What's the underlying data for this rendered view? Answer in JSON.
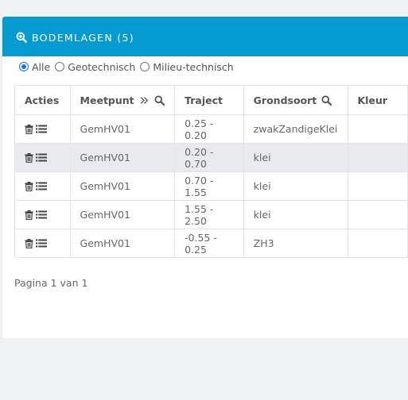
{
  "panel": {
    "title": "BODEMLAGEN (5)",
    "header_icon": "zoom-in-icon"
  },
  "filter": {
    "options": [
      {
        "label": "Alle",
        "checked": true
      },
      {
        "label": "Geotechnisch",
        "checked": false
      },
      {
        "label": "Milieu-technisch",
        "checked": false
      }
    ]
  },
  "table": {
    "columns": [
      "Acties",
      "Meetpunt",
      "Traject",
      "Grondsoort",
      "Kleur"
    ],
    "rows": [
      {
        "meetpunt": "GemHV01",
        "traject": "0.25 - 0.20",
        "grondsoort": "zwakZandigeKlei",
        "kleur": ""
      },
      {
        "meetpunt": "GemHV01",
        "traject": "0.20 - 0.70",
        "grondsoort": "klei",
        "kleur": ""
      },
      {
        "meetpunt": "GemHV01",
        "traject": "0.70 - 1.55",
        "grondsoort": "klei",
        "kleur": ""
      },
      {
        "meetpunt": "GemHV01",
        "traject": "1.55 - 2.50",
        "grondsoort": "klei",
        "kleur": ""
      },
      {
        "meetpunt": "GemHV01",
        "traject": "-0.55 - 0.25",
        "grondsoort": "ZH3",
        "kleur": ""
      }
    ]
  },
  "pager": {
    "text": "Pagina 1 van 1"
  },
  "colors": {
    "header": "#059bd1",
    "row_alt": "#e8eaed",
    "radio_checked": "#1a73e8"
  }
}
